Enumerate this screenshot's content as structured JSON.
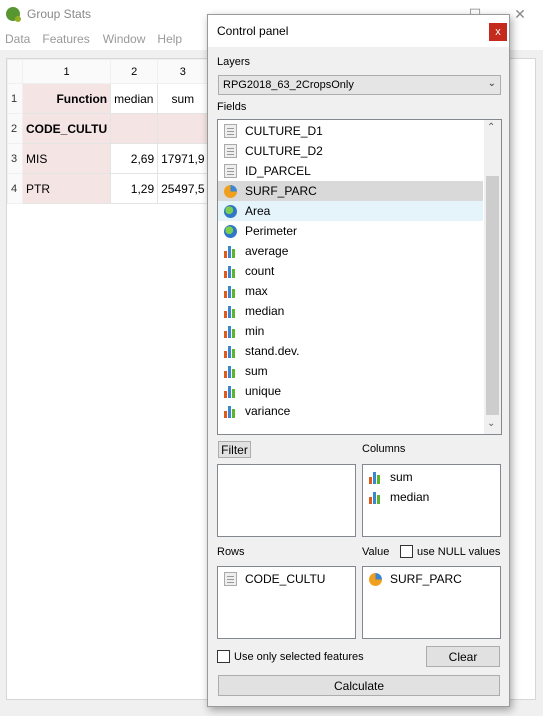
{
  "app": {
    "title": "Group Stats",
    "min": "—",
    "max": "☐",
    "close": "✕"
  },
  "menu": [
    "Data",
    "Features",
    "Window",
    "Help"
  ],
  "sheet": {
    "col_headers": [
      "1",
      "2",
      "3"
    ],
    "row_headers": [
      "1",
      "2",
      "3",
      "4"
    ],
    "rows": [
      [
        "Function",
        "median",
        "sum"
      ],
      [
        "CODE_CULTU",
        "",
        ""
      ],
      [
        "MIS",
        "2,69",
        "17971,9"
      ],
      [
        "PTR",
        "1,29",
        "25497,5"
      ]
    ]
  },
  "panel": {
    "title": "Control panel",
    "close": "x",
    "layers_label": "Layers",
    "layer_selected": "RPG2018_63_2CropsOnly",
    "fields_label": "Fields",
    "fields": [
      {
        "name": "CULTURE_D1",
        "icon": "doc-icon"
      },
      {
        "name": "CULTURE_D2",
        "icon": "doc-icon"
      },
      {
        "name": "ID_PARCEL",
        "icon": "doc-icon"
      },
      {
        "name": "SURF_PARC",
        "icon": "pie-icon"
      },
      {
        "name": "Area",
        "icon": "globe-icon"
      },
      {
        "name": "Perimeter",
        "icon": "globe-icon"
      },
      {
        "name": "average",
        "icon": "bars-icon"
      },
      {
        "name": "count",
        "icon": "bars-icon"
      },
      {
        "name": "max",
        "icon": "bars-icon"
      },
      {
        "name": "median",
        "icon": "bars-icon"
      },
      {
        "name": "min",
        "icon": "bars-icon"
      },
      {
        "name": "stand.dev.",
        "icon": "bars-icon"
      },
      {
        "name": "sum",
        "icon": "bars-icon"
      },
      {
        "name": "unique",
        "icon": "bars-icon"
      },
      {
        "name": "variance",
        "icon": "bars-icon"
      }
    ],
    "filter_label": "Filter",
    "columns_label": "Columns",
    "columns": [
      "sum",
      "median"
    ],
    "rows_label": "Rows",
    "rows": [
      "CODE_CULTU"
    ],
    "value_label": "Value",
    "use_null_label": "use NULL values",
    "value": [
      "SURF_PARC"
    ],
    "only_selected_label": "Use only selected features",
    "clear_label": "Clear",
    "calculate_label": "Calculate"
  }
}
